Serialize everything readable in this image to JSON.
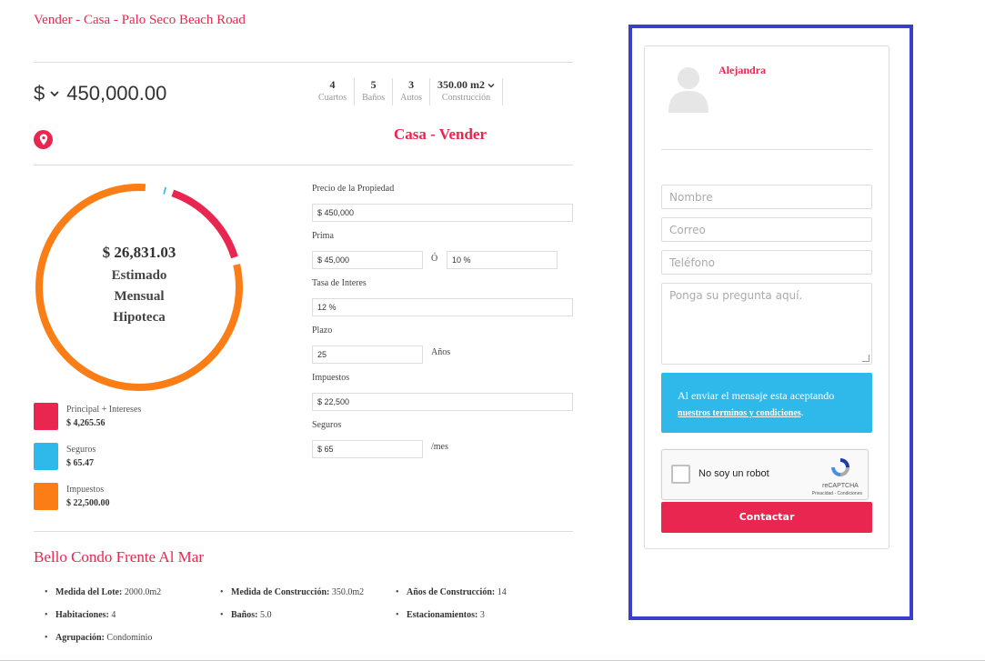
{
  "listing": {
    "title": "Vender - Casa - Palo Seco Beach Road",
    "currency": "$",
    "price": "450,000.00",
    "subtitle": "Casa - Vender",
    "stats": [
      {
        "value": "4",
        "label": "Cuartos"
      },
      {
        "value": "5",
        "label": "Baños"
      },
      {
        "value": "3",
        "label": "Autos"
      },
      {
        "value": "350.00 m2",
        "label": "Construcción"
      }
    ]
  },
  "mortgage": {
    "amount": "$ 26,831.03",
    "label_lines": [
      "Estimado",
      "Mensual",
      "Hipoteca"
    ],
    "legend": [
      {
        "label": "Principal + Intereses",
        "value": "$ 4,265.56",
        "color": "#e8264f"
      },
      {
        "label": "Seguros",
        "value": "$ 65.47",
        "color": "#2fb9ea"
      },
      {
        "label": "Impuestos",
        "value": "$ 22,500.00",
        "color": "#fb7d15"
      }
    ],
    "shares": {
      "principal": 0.159,
      "seguros": 0.0024,
      "impuestos": 0.8386
    }
  },
  "calculator": {
    "price_label": "Precio de la Propiedad",
    "price_value": "$ 450,000",
    "prima_label": "Prima",
    "prima_value": "$ 45,000",
    "or_label": "Ó",
    "prima_pct": "10 %",
    "rate_label": "Tasa de Interes",
    "rate_value": "12 %",
    "term_label": "Plazo",
    "term_value": "25",
    "term_unit": "Años",
    "tax_label": "Impuestos",
    "tax_value": "$ 22,500",
    "insurance_label": "Seguros",
    "insurance_value": "$ 65",
    "insurance_unit": "/mes"
  },
  "details": {
    "title": "Bello Condo Frente Al Mar",
    "features": [
      {
        "key": "Medida del Lote:",
        "value": "2000.0m2"
      },
      {
        "key": "Medida de Construcción:",
        "value": "350.0m2"
      },
      {
        "key": "Años de Construcción:",
        "value": "14"
      },
      {
        "key": "Habitaciones:",
        "value": "4"
      },
      {
        "key": "Baños:",
        "value": "5.0"
      },
      {
        "key": "Estacionamientos:",
        "value": "3"
      },
      {
        "key": "Agrupación:",
        "value": "Condominio"
      }
    ]
  },
  "contact": {
    "agent_name": "Alejandra",
    "name_placeholder": "Nombre",
    "email_placeholder": "Correo",
    "phone_placeholder": "Teléfono",
    "question_placeholder": "Ponga su pregunta aquí.",
    "notice_text": "Al enviar el mensaje esta aceptando",
    "notice_link": "nuestros terminos y condiciones",
    "notice_end": ".",
    "captcha_label": "No soy un robot",
    "captcha_brand": "reCAPTCHA",
    "captcha_links": "Privacidad - Condiciones",
    "submit_label": "Contactar"
  }
}
